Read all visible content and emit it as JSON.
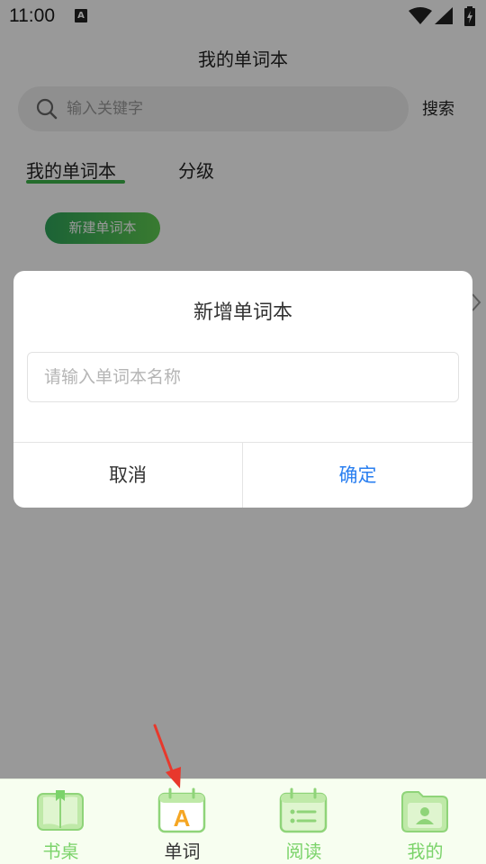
{
  "status_bar": {
    "time": "11:00",
    "notification_icon_letter": "A",
    "icons": [
      "wifi-icon",
      "signal-icon",
      "battery-icon"
    ]
  },
  "header": {
    "title": "我的单词本"
  },
  "search": {
    "placeholder": "输入关键字",
    "button_label": "搜索"
  },
  "tabs": [
    {
      "label": "我的单词本",
      "active": true
    },
    {
      "label": "分级",
      "active": false
    }
  ],
  "new_book_button": "新建单词本",
  "dialog": {
    "title": "新增单词本",
    "input_placeholder": "请输入单词本名称",
    "input_value": "",
    "cancel_label": "取消",
    "confirm_label": "确定"
  },
  "bottom_nav": {
    "items": [
      {
        "label": "书桌",
        "icon": "book-icon",
        "active": false
      },
      {
        "label": "单词",
        "icon": "word-a-icon",
        "active": true,
        "icon_letter": "A"
      },
      {
        "label": "阅读",
        "icon": "reading-list-icon",
        "active": false
      },
      {
        "label": "我的",
        "icon": "profile-folder-icon",
        "active": false
      }
    ]
  },
  "colors": {
    "accent_green": "#3cb44a",
    "confirm_blue": "#2a7ff0",
    "nav_green": "#7bd36a",
    "word_icon_orange": "#f5a623",
    "overlay": "rgba(0,0,0,0.4)",
    "annotation_red": "#e8382c"
  }
}
